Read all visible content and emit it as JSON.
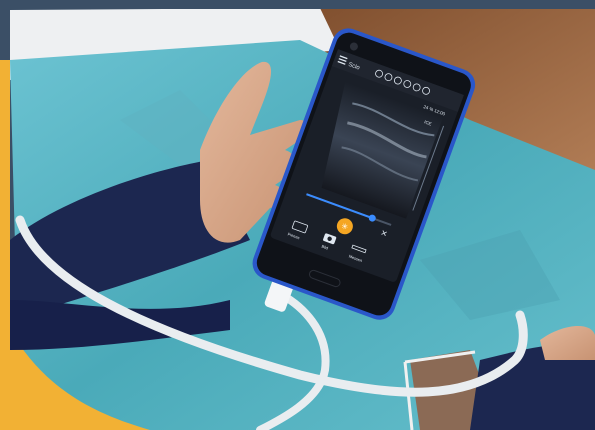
{
  "phone": {
    "app_title": "Scio",
    "status_right": "24 %  12:00",
    "mode_label": "ICE",
    "toolbar": {
      "freeze_label": "Freeze",
      "capture_label": "Bild",
      "measure_label": "Messen"
    }
  },
  "colors": {
    "frame_blue": "#3b4f66",
    "accent_orange": "#f2b134",
    "drape_teal": "#5fb8c9",
    "sleeve_navy": "#1c2750",
    "phone_blue": "#2a57c9",
    "freeze_button": "#f5a623"
  },
  "icons": [
    "menu-icon",
    "mode-icons",
    "keyboard-icon",
    "camera-icon",
    "ruler-icon",
    "snowflake-icon",
    "settings-icon"
  ]
}
